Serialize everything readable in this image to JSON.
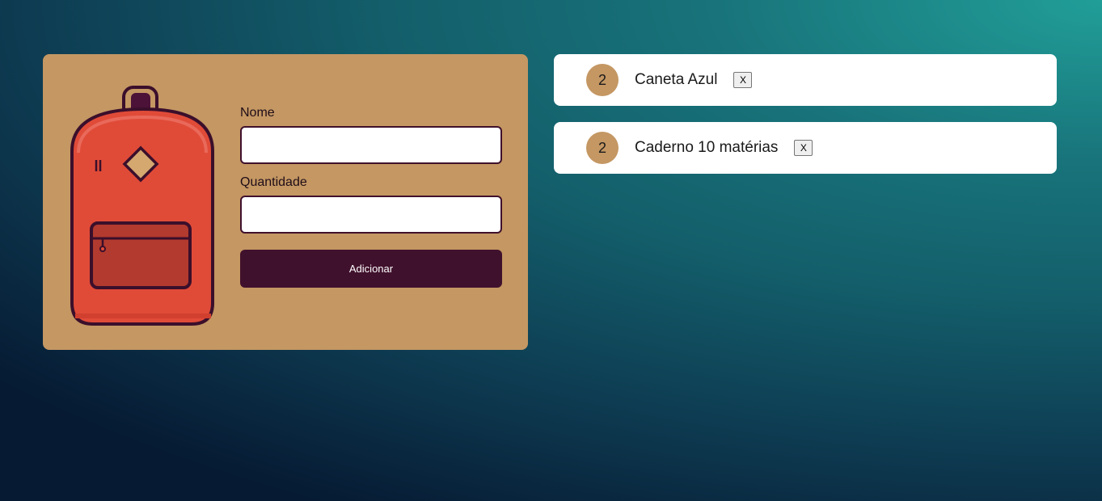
{
  "form": {
    "name_label": "Nome",
    "name_value": "",
    "quantity_label": "Quantidade",
    "quantity_value": "",
    "submit_label": "Adicionar"
  },
  "items": [
    {
      "quantity": "2",
      "name": "Caneta Azul",
      "remove_label": "X"
    },
    {
      "quantity": "2",
      "name": "Caderno 10 matérias",
      "remove_label": "X"
    }
  ],
  "colors": {
    "background_top": "#219e98",
    "background_bottom": "#061a33",
    "card": "#c49763",
    "button": "#40112c",
    "badge": "#c49763",
    "backpack_red": "#e04b38"
  },
  "icons": {
    "illustration": "backpack-icon"
  }
}
